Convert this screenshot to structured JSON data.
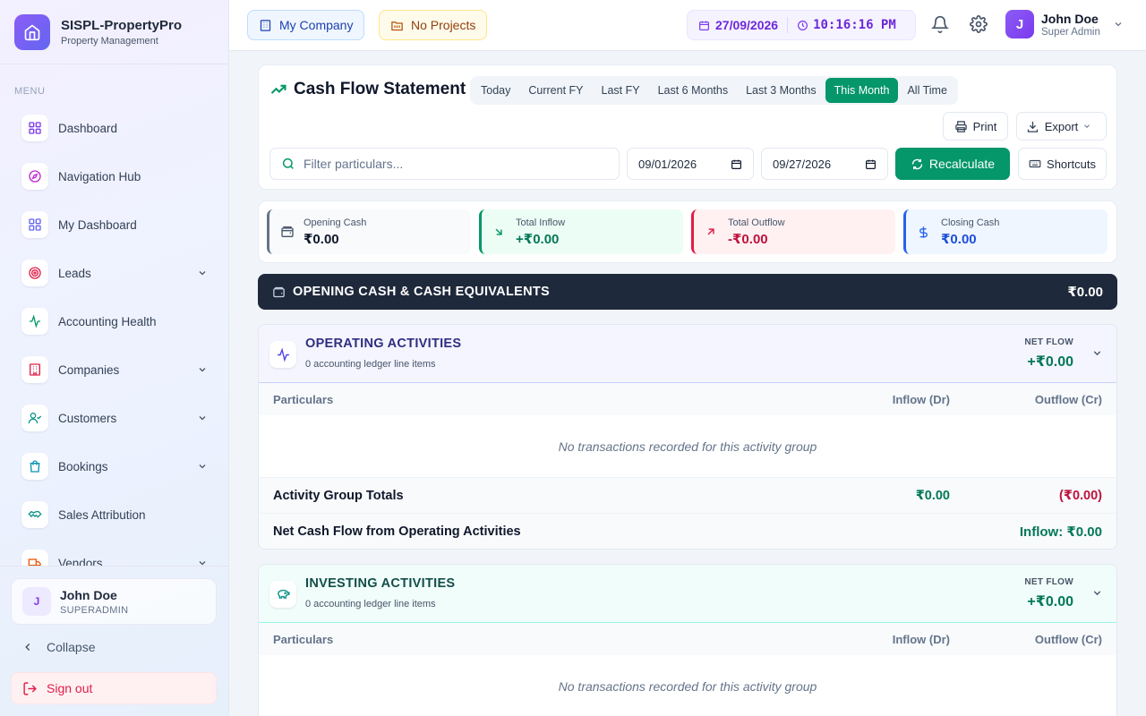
{
  "brand": {
    "name": "SISPL-PropertyPro",
    "subtitle": "Property Management"
  },
  "sidebar": {
    "menu_label": "MENU",
    "items": [
      {
        "label": "Dashboard",
        "icon": "grid-icon",
        "expandable": false
      },
      {
        "label": "Navigation Hub",
        "icon": "compass-icon",
        "expandable": false
      },
      {
        "label": "My Dashboard",
        "icon": "grid-icon",
        "expandable": false
      },
      {
        "label": "Leads",
        "icon": "target-icon",
        "expandable": true
      },
      {
        "label": "Accounting Health",
        "icon": "activity-icon",
        "expandable": false
      },
      {
        "label": "Companies",
        "icon": "building-icon",
        "expandable": true
      },
      {
        "label": "Customers",
        "icon": "user-check-icon",
        "expandable": true
      },
      {
        "label": "Bookings",
        "icon": "shopping-bag-icon",
        "expandable": true
      },
      {
        "label": "Sales Attribution",
        "icon": "handshake-icon",
        "expandable": false
      },
      {
        "label": "Vendors",
        "icon": "truck-icon",
        "expandable": true
      }
    ],
    "user": {
      "initial": "J",
      "name": "John Doe",
      "role": "SUPERADMIN"
    },
    "collapse_label": "Collapse",
    "signout_label": "Sign out"
  },
  "topbar": {
    "company_chip": "My Company",
    "projects_chip": "No Projects",
    "date": "27/09/2026",
    "time": "10:16:16 PM",
    "user": {
      "initial": "J",
      "name": "John Doe",
      "role": "Super Admin"
    }
  },
  "page": {
    "title": "Cash Flow Statement",
    "range_tabs": [
      "Today",
      "Current FY",
      "Last FY",
      "Last 6 Months",
      "Last 3 Months",
      "This Month",
      "All Time"
    ],
    "active_range": "This Month",
    "print_label": "Print",
    "export_label": "Export",
    "filter_placeholder": "Filter particulars...",
    "date_from": "09/01/2026",
    "date_to": "09/27/2026",
    "recalc_label": "Recalculate",
    "shortcuts_label": "Shortcuts"
  },
  "summary": [
    {
      "label": "Opening Cash",
      "value": "₹0.00",
      "color": "#64748b"
    },
    {
      "label": "Total Inflow",
      "value": "+₹0.00",
      "color": "#059669"
    },
    {
      "label": "Total Outflow",
      "value": "-₹0.00",
      "color": "#e11d48"
    },
    {
      "label": "Closing Cash",
      "value": "₹0.00",
      "color": "#2563eb"
    }
  ],
  "opening": {
    "title": "OPENING CASH & CASH EQUIVALENTS",
    "value": "₹0.00"
  },
  "activities": [
    {
      "title": "OPERATING ACTIVITIES",
      "subtitle": "0 accounting ledger line items",
      "net_label": "NET FLOW",
      "net_value": "+₹0.00",
      "columns": [
        "Particulars",
        "Inflow (Dr)",
        "Outflow (Cr)"
      ],
      "empty_text": "No transactions recorded for this activity group",
      "totals_label": "Activity Group Totals",
      "totals_inflow": "₹0.00",
      "totals_outflow": "(₹0.00)",
      "net_row_label": "Net Cash Flow from Operating Activities",
      "net_row_value": "Inflow: ₹0.00",
      "accent": "#312e81"
    },
    {
      "title": "INVESTING ACTIVITIES",
      "subtitle": "0 accounting ledger line items",
      "net_label": "NET FLOW",
      "net_value": "+₹0.00",
      "columns": [
        "Particulars",
        "Inflow (Dr)",
        "Outflow (Cr)"
      ],
      "empty_text": "No transactions recorded for this activity group",
      "accent": "#134e4a"
    }
  ],
  "colors": {
    "primary": "#059669",
    "brand": "#7c3aed",
    "dark": "#1e293b"
  }
}
